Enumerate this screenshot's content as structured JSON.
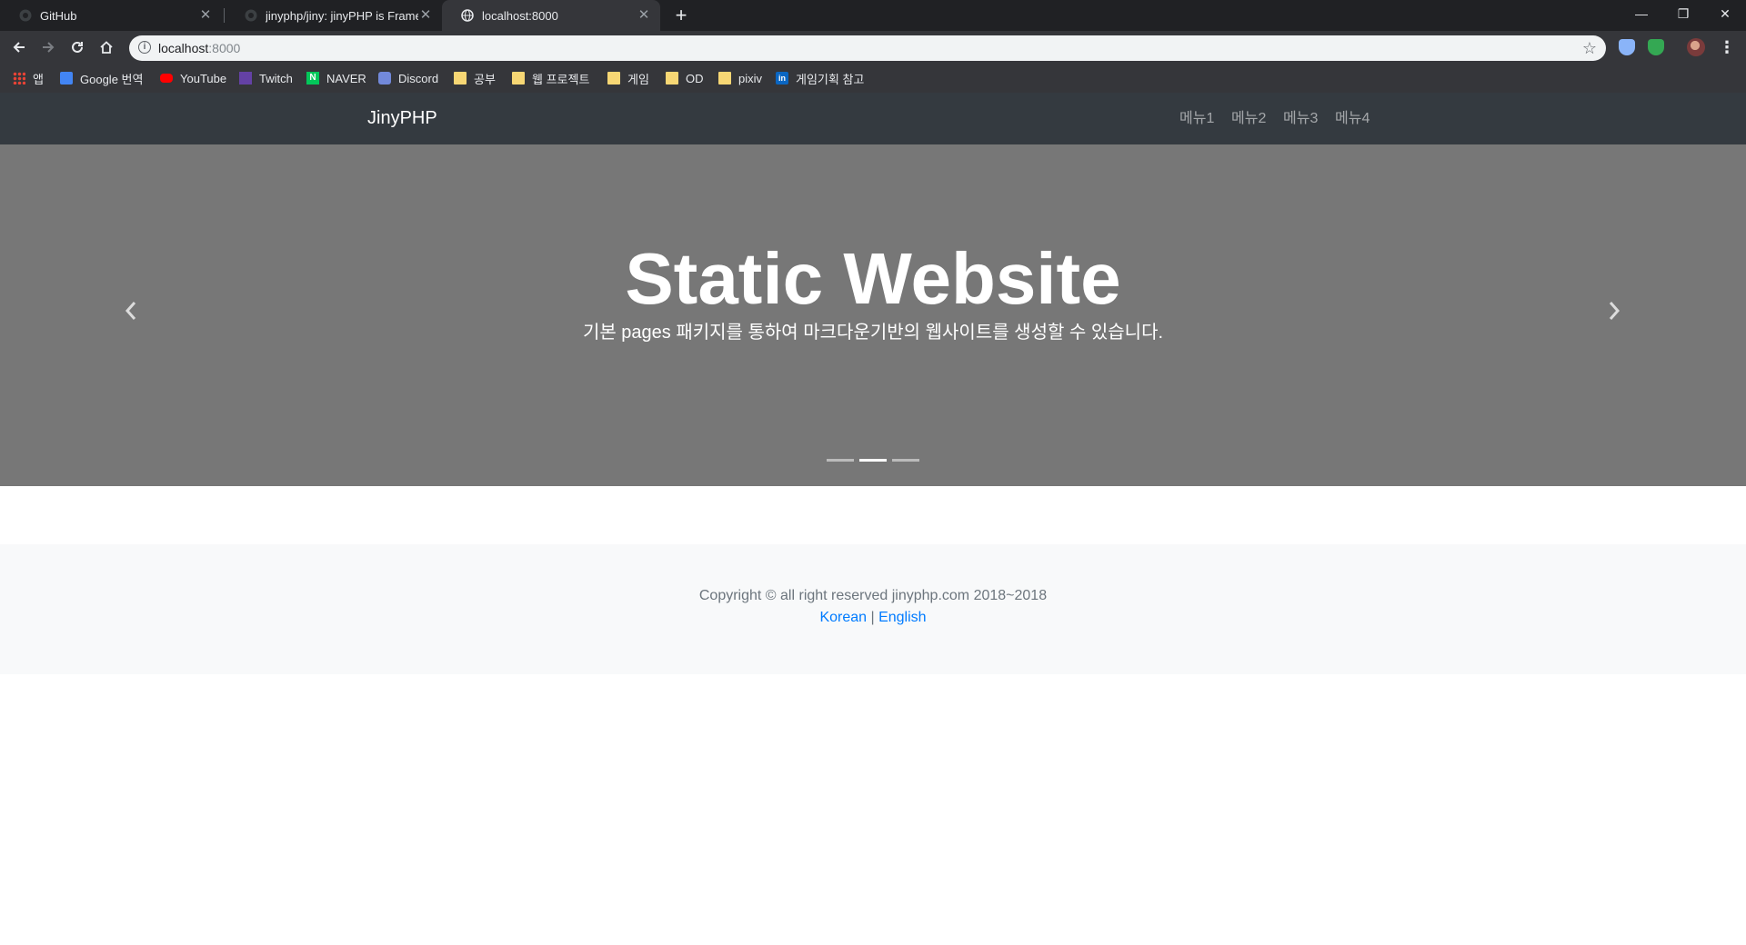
{
  "browser": {
    "tabs": [
      {
        "title": "GitHub",
        "icon": "github-icon"
      },
      {
        "title": "jinyphp/jiny: jinyPHP is Framework",
        "icon": "github-icon"
      },
      {
        "title": "localhost:8000",
        "icon": "globe-icon",
        "active": true
      }
    ],
    "address": {
      "host": "localhost",
      "port": ":8000"
    },
    "bookmarks": [
      {
        "label": "앱",
        "icon": "apps-grid-icon"
      },
      {
        "label": "Google 번역",
        "icon": "google-translate-icon"
      },
      {
        "label": "YouTube",
        "icon": "youtube-icon"
      },
      {
        "label": "Twitch",
        "icon": "twitch-icon"
      },
      {
        "label": "NAVER",
        "icon": "naver-icon"
      },
      {
        "label": "Discord",
        "icon": "discord-icon"
      },
      {
        "label": "공부",
        "icon": "folder-icon"
      },
      {
        "label": "웹 프로젝트",
        "icon": "folder-icon"
      },
      {
        "label": "게임",
        "icon": "folder-icon"
      },
      {
        "label": "OD",
        "icon": "folder-icon"
      },
      {
        "label": "pixiv",
        "icon": "folder-icon"
      },
      {
        "label": "게임기획 참고",
        "icon": "linkedin-icon"
      }
    ]
  },
  "site": {
    "brand": "JinyPHP",
    "menu": [
      "메뉴1",
      "메뉴2",
      "메뉴3",
      "메뉴4"
    ],
    "hero": {
      "title": "Static Website",
      "subtitle": "기본 pages 패키지를 통하여 마크다운기반의 웹사이트를 생성할 수 있습니다.",
      "slide_count": 3,
      "active_slide": 2
    },
    "footer": {
      "copyright": "Copyright © all right reserved jinyphp.com 2018~2018",
      "lang_korean": "Korean",
      "lang_separator": " | ",
      "lang_english": "English"
    }
  },
  "colors": {
    "navbar": "#343a40",
    "carousel": "#777777",
    "footer": "#f8f9fa",
    "link": "#007bff"
  }
}
